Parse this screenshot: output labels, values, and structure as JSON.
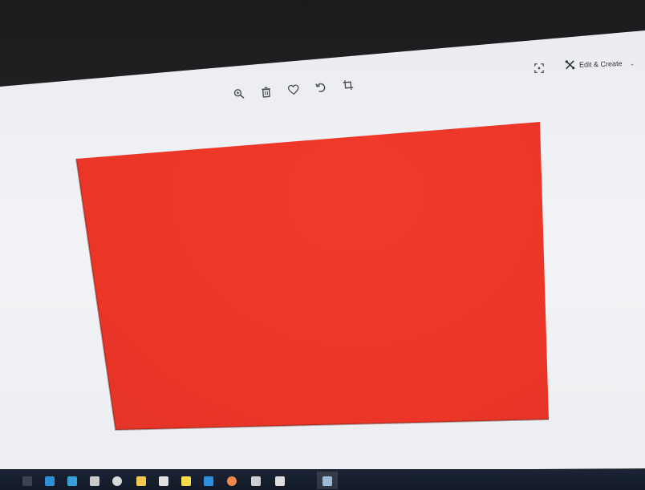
{
  "toolbar": {
    "zoom_icon": "zoom-in-icon",
    "delete_icon": "trash-icon",
    "favorite_icon": "heart-icon",
    "rotate_icon": "rotate-icon",
    "crop_icon": "crop-icon"
  },
  "header": {
    "edit_create_label": "Edit & Create",
    "fullscreen_icon": "fullscreen-icon"
  },
  "photo": {
    "fill_color": "#ea3527"
  },
  "taskbar": {
    "apps": [
      {
        "icon": "start-icon",
        "color": "#3b4252"
      },
      {
        "icon": "edge-icon",
        "color": "#2f8fd8"
      },
      {
        "icon": "store-icon",
        "color": "#3aa0d8"
      },
      {
        "icon": "lock-icon",
        "color": "#c9c9c9"
      },
      {
        "icon": "chrome-icon",
        "color": "#d9d9d9"
      },
      {
        "icon": "folder-icon",
        "color": "#f2c94c"
      },
      {
        "icon": "file-icon",
        "color": "#e0e0e0"
      },
      {
        "icon": "notes-icon",
        "color": "#f7d94c"
      },
      {
        "icon": "vscode-icon",
        "color": "#2d8fe0"
      },
      {
        "icon": "app-icon",
        "color": "#f08a4b"
      },
      {
        "icon": "window-icon",
        "color": "#cfcfcf"
      },
      {
        "icon": "window-icon",
        "color": "#dedede"
      },
      {
        "icon": "photos-icon",
        "color": "#9fb8d8"
      }
    ]
  }
}
